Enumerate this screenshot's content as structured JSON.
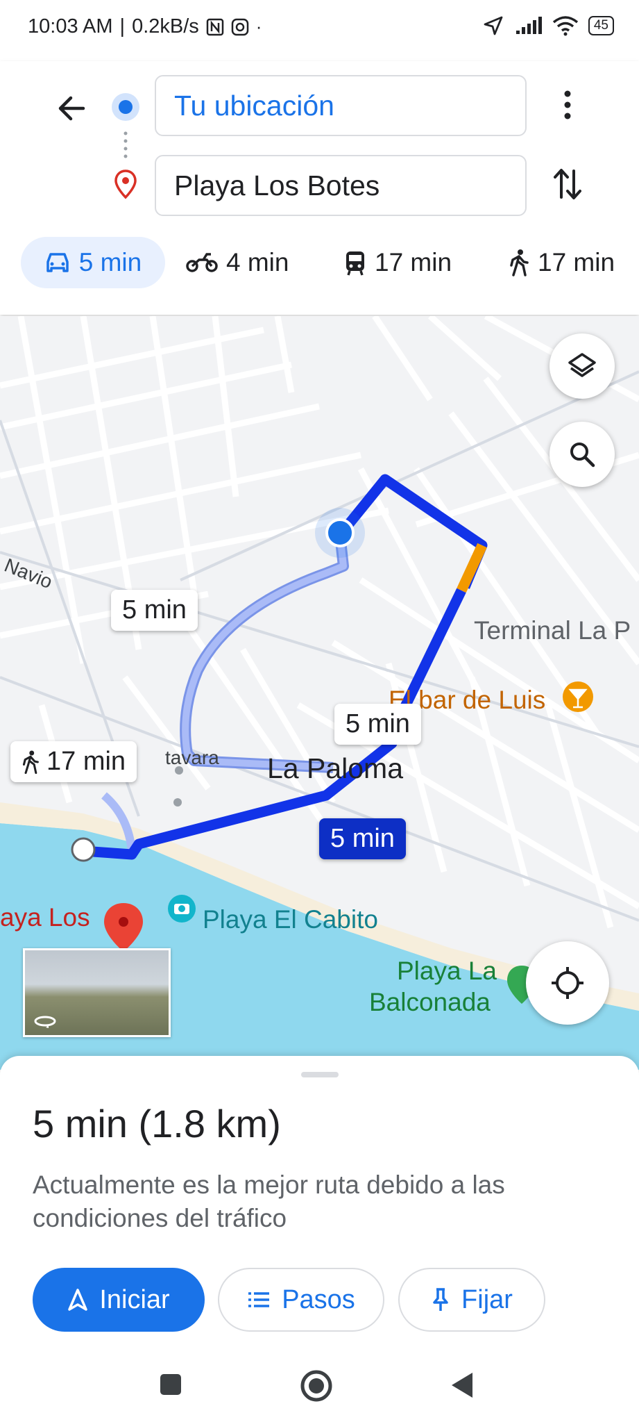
{
  "status_bar": {
    "time": "10:03 AM",
    "net_speed": "0.2kB/s",
    "battery": "45"
  },
  "directions": {
    "origin": "Tu ubicación",
    "destination": "Playa Los Botes"
  },
  "modes": [
    {
      "icon": "car-icon",
      "label": "5 min"
    },
    {
      "icon": "motorcycle-icon",
      "label": "4 min"
    },
    {
      "icon": "transit-icon",
      "label": "17 min"
    },
    {
      "icon": "walk-icon",
      "label": "17 min"
    }
  ],
  "map": {
    "route_labels": {
      "alternative": "5 min",
      "middle": "5 min",
      "selected": "5 min",
      "walking": "17 min"
    },
    "places": {
      "street_navio": "Navio",
      "street_atavara": "tavara",
      "la_paloma": "La Paloma",
      "terminal": "Terminal La P",
      "bar": "El bar de Luis",
      "playa_el_cabito": "Playa El Cabito",
      "playa_la_balconada_1": "Playa La",
      "playa_la_balconada_2": "Balconada",
      "playa_los_botes": "aya Los"
    },
    "colors": {
      "route_selected": "#1233e8",
      "route_alt": "#aabbf7",
      "traffic": "#f29900",
      "water": "#8fd8ee",
      "sand": "#f6eedc"
    }
  },
  "sheet": {
    "time": "5 min",
    "distance": "(1.8 km)",
    "description": "Actualmente es la mejor ruta debido a las condiciones del tráfico",
    "buttons": {
      "start": "Iniciar",
      "steps": "Pasos",
      "pin": "Fijar"
    }
  }
}
